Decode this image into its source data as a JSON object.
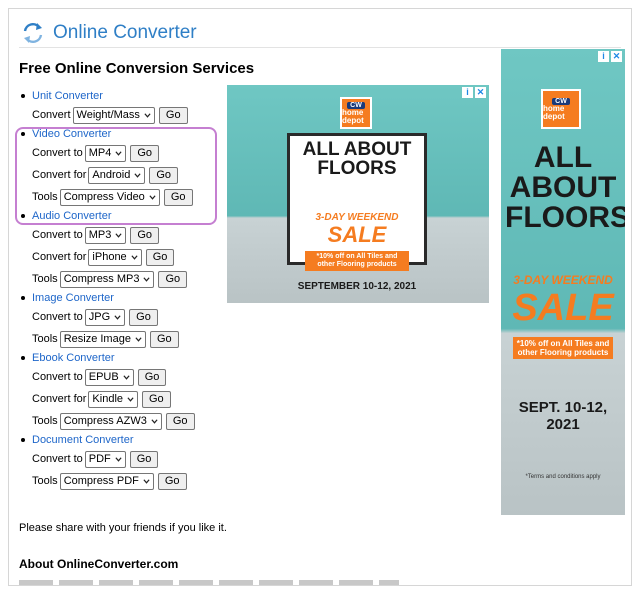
{
  "app": {
    "brand": "Online Converter"
  },
  "page_title": "Free Online Conversion Services",
  "sections": [
    {
      "title": "Unit Converter",
      "rows": [
        {
          "label": "Convert",
          "value": "Weight/Mass",
          "go": "Go"
        }
      ]
    },
    {
      "title": "Video Converter",
      "rows": [
        {
          "label": "Convert to",
          "value": "MP4",
          "go": "Go"
        },
        {
          "label": "Convert for",
          "value": "Android",
          "go": "Go"
        },
        {
          "label": "Tools",
          "value": "Compress Video",
          "go": "Go"
        }
      ]
    },
    {
      "title": "Audio Converter",
      "rows": [
        {
          "label": "Convert to",
          "value": "MP3",
          "go": "Go"
        },
        {
          "label": "Convert for",
          "value": "iPhone",
          "go": "Go"
        },
        {
          "label": "Tools",
          "value": "Compress MP3",
          "go": "Go"
        }
      ]
    },
    {
      "title": "Image Converter",
      "rows": [
        {
          "label": "Convert to",
          "value": "JPG",
          "go": "Go"
        },
        {
          "label": "Tools",
          "value": "Resize Image",
          "go": "Go"
        }
      ]
    },
    {
      "title": "Ebook Converter",
      "rows": [
        {
          "label": "Convert to",
          "value": "EPUB",
          "go": "Go"
        },
        {
          "label": "Convert for",
          "value": "Kindle",
          "go": "Go"
        },
        {
          "label": "Tools",
          "value": "Compress AZW3",
          "go": "Go"
        }
      ]
    },
    {
      "title": "Document Converter",
      "rows": [
        {
          "label": "Convert to",
          "value": "PDF",
          "go": "Go"
        },
        {
          "label": "Tools",
          "value": "Compress PDF",
          "go": "Go"
        }
      ]
    }
  ],
  "share_text": "Please share with your friends if you like it.",
  "about_title": "About OnlineConverter.com",
  "ad": {
    "logo_cw": "CW",
    "logo_text": "home depot",
    "headline": "ALL ABOUT FLOORS",
    "weekend": "3-DAY WEEKEND",
    "sale": "SALE",
    "offer": "*10% off on All Tiles and other Flooring products",
    "date_wide": "SEPTEMBER 10-12, 2021",
    "date_tall": "SEPT. 10-12, 2021",
    "fine_tall": "*Terms and conditions apply"
  },
  "colors": {
    "link": "#1e66c9",
    "brand": "#2f7fc6",
    "highlight": "#c57fd1",
    "ad_orange": "#f57c20",
    "ad_teal": "#6fc7c3"
  }
}
